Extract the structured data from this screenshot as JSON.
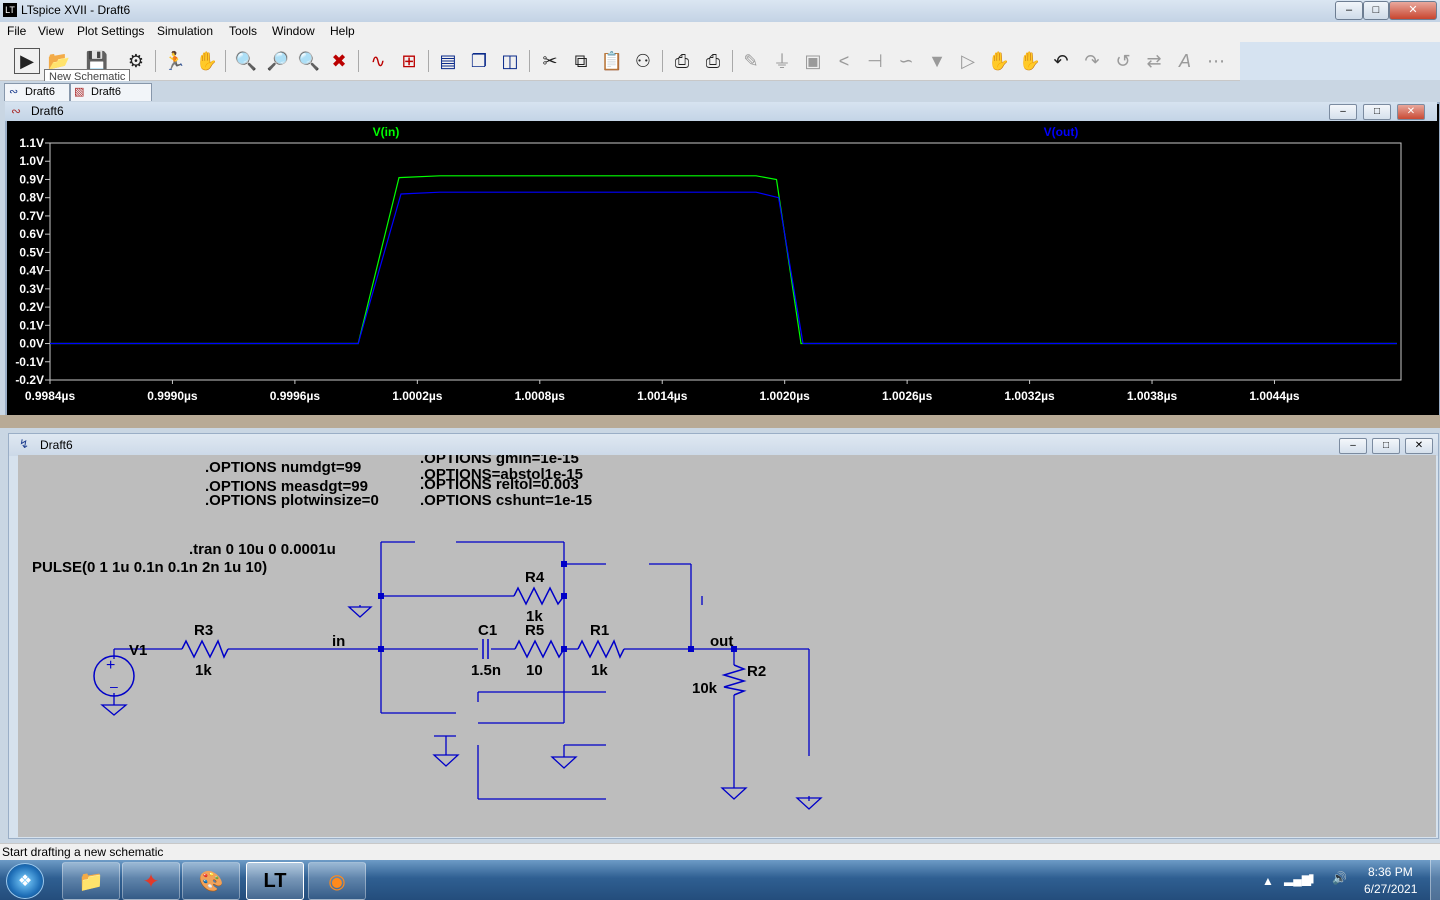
{
  "app": {
    "title": "LTspice XVII - Draft6"
  },
  "menu": [
    "File",
    "View",
    "Plot Settings",
    "Simulation",
    "Tools",
    "Window",
    "Help"
  ],
  "toolbar": {
    "tooltip": "New Schematic",
    "icons": [
      "run-icon",
      "open-icon",
      "save-icon",
      "control-panel-icon",
      "run-script-icon",
      "halt-icon",
      "zoom-in-icon",
      "pan-icon",
      "zoom-out-icon",
      "zoom-cancel-icon",
      "autorange-icon",
      "mark-icon",
      "tile-horizontal-icon",
      "cascade-icon",
      "tile-vertical-icon",
      "cut-icon",
      "copy-icon",
      "paste-icon",
      "find-icon",
      "print-icon",
      "print-setup-icon",
      "draw-wire-icon",
      "ground-icon",
      "label-net-icon",
      "resistor-icon",
      "capacitor-icon",
      "inductor-icon",
      "diode-icon",
      "component-icon",
      "move-icon",
      "drag-icon",
      "undo-icon",
      "redo-icon",
      "rotate-icon",
      "mirror-icon",
      "text-icon",
      "spice-directive-icon"
    ]
  },
  "tabs": [
    {
      "label": "Draft6"
    },
    {
      "label": "Draft6"
    }
  ],
  "plot_window": {
    "title": "Draft6"
  },
  "schematic_window": {
    "title": "Draft6",
    "directives": [
      ".OPTIONS numdgt=99",
      ".OPTIONS measdgt=99",
      ".OPTIONS plotwinsize=0",
      ".OPTIONS gmin=1e-15",
      ".OPTIONS=abstol1e-15",
      ".OPTIONS reltol=0.003",
      ".OPTIONS cshunt=1e-15",
      ".tran 0 10u 0 0.0001u"
    ],
    "source_value": "PULSE(0 1 1u 0.1n 0.1n 2n 1u 10)",
    "components": [
      {
        "name": "V1",
        "value": ""
      },
      {
        "name": "R3",
        "value": "1k"
      },
      {
        "name": "R4",
        "value": "1k"
      },
      {
        "name": "C1",
        "value": "1.5n"
      },
      {
        "name": "R5",
        "value": "10"
      },
      {
        "name": "R1",
        "value": "1k"
      },
      {
        "name": "R2",
        "value": "10k"
      }
    ],
    "net_labels": [
      "in",
      "out"
    ]
  },
  "chart_data": {
    "type": "line",
    "title": "",
    "xlabel": "",
    "ylabel": "",
    "series": [
      {
        "name": "V(in)",
        "color": "#00ff00",
        "x": [
          0.9984,
          0.99991,
          1.00011,
          1.00031,
          1.00186,
          1.00196,
          1.00208,
          1.00209,
          1.005
        ],
        "y": [
          0.0,
          0.0,
          0.91,
          0.92,
          0.92,
          0.9,
          0.0,
          0.0,
          0.0
        ]
      },
      {
        "name": "V(out)",
        "color": "#0000ff",
        "x": [
          0.9984,
          0.99991,
          1.00012,
          1.00031,
          1.00186,
          1.00197,
          1.00209,
          1.00212,
          1.005
        ],
        "y": [
          0.0,
          0.0,
          0.82,
          0.83,
          0.83,
          0.8,
          0.0,
          0.0,
          0.0
        ]
      }
    ],
    "x_ticks": [
      "0.9984µs",
      "0.9990µs",
      "0.9996µs",
      "1.0002µs",
      "1.0008µs",
      "1.0014µs",
      "1.0020µs",
      "1.0026µs",
      "1.0032µs",
      "1.0038µs",
      "1.0044µs"
    ],
    "x_tick_values": [
      0.9984,
      0.999,
      0.9996,
      1.0002,
      1.0008,
      1.0014,
      1.002,
      1.0026,
      1.0032,
      1.0038,
      1.0044
    ],
    "y_ticks": [
      "1.1V",
      "1.0V",
      "0.9V",
      "0.8V",
      "0.7V",
      "0.6V",
      "0.5V",
      "0.4V",
      "0.3V",
      "0.2V",
      "0.1V",
      "0.0V",
      "-0.1V",
      "-0.2V"
    ],
    "y_tick_values": [
      1.1,
      1.0,
      0.9,
      0.8,
      0.7,
      0.6,
      0.5,
      0.4,
      0.3,
      0.2,
      0.1,
      0.0,
      -0.1,
      -0.2
    ],
    "xlim": [
      0.9984,
      1.00502
    ],
    "ylim": [
      -0.2,
      1.1
    ],
    "grid": false,
    "legend": "top"
  },
  "status": {
    "text": "Start drafting a new schematic"
  },
  "taskbar": {
    "time": "8:36 PM",
    "date": "6/27/2021",
    "apps": [
      "explorer-icon",
      "acrobat-icon",
      "paint-icon",
      "ltspice-icon",
      "firefox-icon"
    ]
  }
}
